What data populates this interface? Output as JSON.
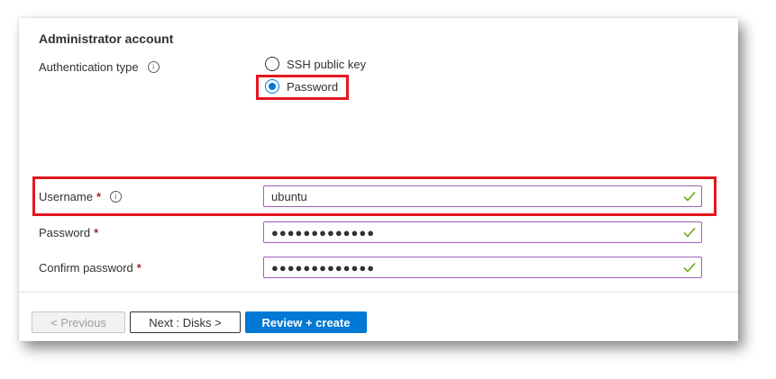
{
  "section": {
    "title": "Administrator account"
  },
  "auth": {
    "label": "Authentication type",
    "info_icon": "info-icon",
    "options": [
      {
        "label": "SSH public key",
        "selected": false
      },
      {
        "label": "Password",
        "selected": true
      }
    ]
  },
  "fields": {
    "username": {
      "label": "Username",
      "required": "*",
      "value": "ubuntu",
      "valid": true
    },
    "password": {
      "label": "Password",
      "required": "*",
      "value": "●●●●●●●●●●●●●",
      "valid": true
    },
    "confirm": {
      "label": "Confirm password",
      "required": "*",
      "value": "●●●●●●●●●●●●●",
      "valid": true
    }
  },
  "footer": {
    "previous_label": "< Previous",
    "next_label": "Next : Disks >",
    "review_label": "Review + create"
  },
  "colors": {
    "accent": "#0078d4",
    "required": "#a4262c",
    "valid_check": "#57a300",
    "highlight": "#e3171f",
    "field_border": "#a05fb8"
  }
}
